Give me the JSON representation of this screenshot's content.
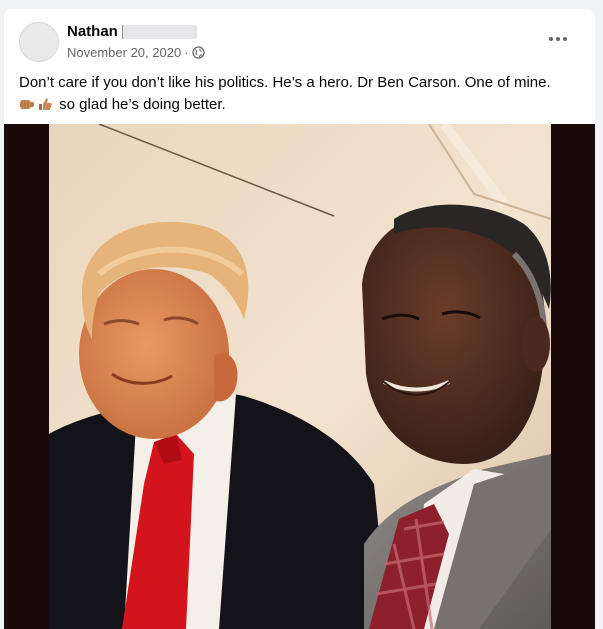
{
  "post": {
    "author": "Nathan",
    "date": "November 20, 2020",
    "separator": "·",
    "text_line1": "Don’t care if you don’t like his politics. He’s a hero. Dr Ben Carson. One of mine.",
    "text_line2": "so glad he’s doing better.",
    "emojis": [
      "fist-bump-icon",
      "thumbs-up-icon"
    ],
    "privacy_icon": "globe-icon",
    "menu_icon": "more-options-icon"
  },
  "colors": {
    "background": "#f0f2f5",
    "card": "#ffffff",
    "secondary_text": "#65676b",
    "photo_frame": "#1a0a0c"
  }
}
